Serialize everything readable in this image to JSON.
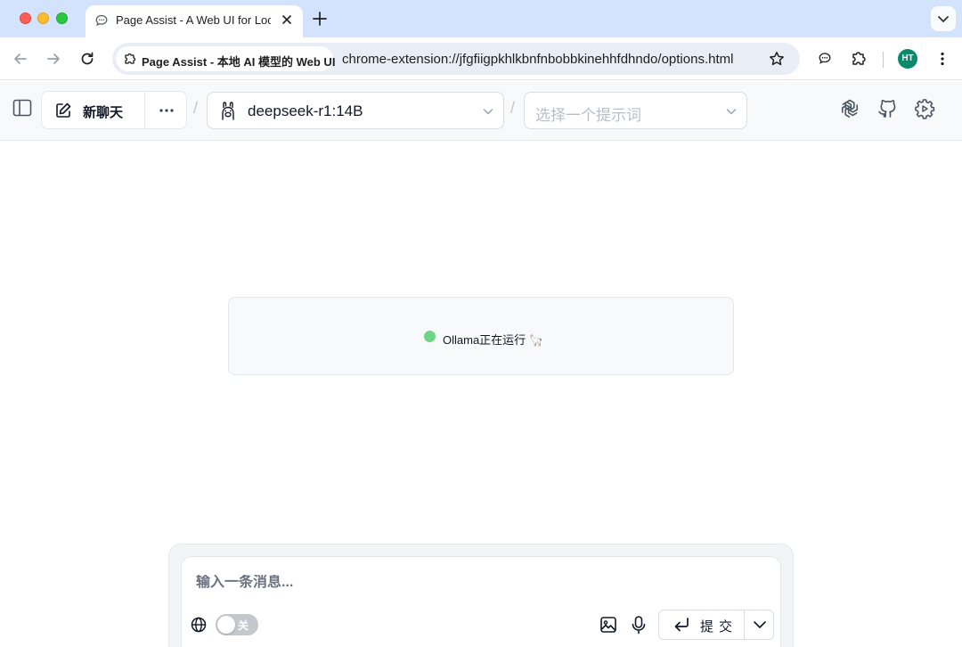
{
  "browser": {
    "tab": {
      "title": "Page Assist - A Web UI for Local AI Models",
      "favicon": "chat-bubble-icon"
    },
    "address": {
      "chip_label": "Page Assist - 本地 AI 模型的 Web UI",
      "url": "chrome-extension://jfgfiigpkhlkbnfnbobbkinehhfdhndo/options.html"
    },
    "profile_initials": "HT"
  },
  "header": {
    "new_chat_label": "新聊天",
    "separator": "/",
    "model": {
      "selected": "deepseek-r1:14B"
    },
    "prompt": {
      "placeholder": "选择一个提示词"
    },
    "icons": [
      "sidebar-icon",
      "edit-icon",
      "more-icon",
      "llama-icon",
      "openai-icon",
      "github-icon",
      "settings-icon"
    ]
  },
  "status": {
    "text": "Ollama正在运行 🦙",
    "color": "#6dd488"
  },
  "composer": {
    "placeholder": "输入一条消息...",
    "web_search_toggle": "关",
    "submit_label": "提交"
  }
}
